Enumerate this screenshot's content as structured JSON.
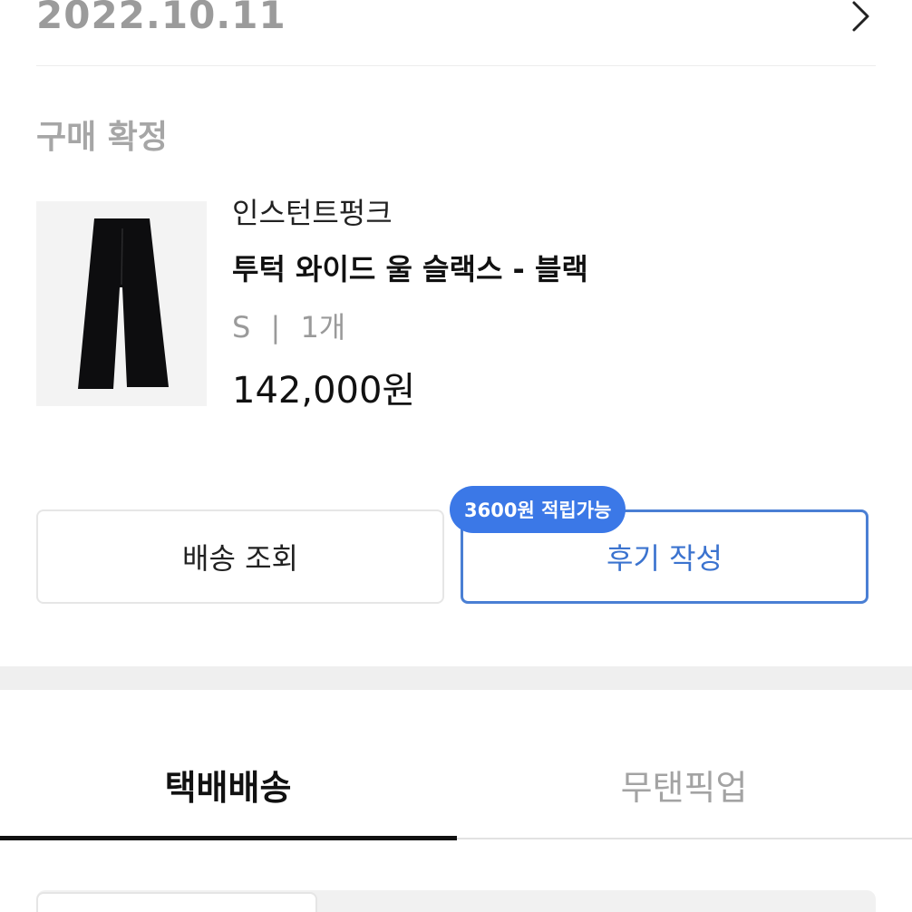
{
  "header": {
    "date": "2022.10.11"
  },
  "order": {
    "status": "구매 확정"
  },
  "product": {
    "brand": "인스턴트펑크",
    "name": "투턱 와이드 울 슬랙스 - 블랙",
    "size": "S",
    "separator": "|",
    "quantity": "1개",
    "price": "142,000원"
  },
  "actions": {
    "track_label": "배송 조회",
    "review_label": "후기 작성",
    "reward_badge": "3600원 적립가능"
  },
  "tabs": [
    {
      "label": "택배배송",
      "active": true
    },
    {
      "label": "무탠픽업",
      "active": false
    }
  ],
  "colors": {
    "accent": "#3b78e7",
    "review_text": "#3b73cf",
    "muted_text": "#9b9b9b"
  },
  "icons": {
    "chevron": "chevron-right-icon",
    "product_image": "pants-image"
  }
}
